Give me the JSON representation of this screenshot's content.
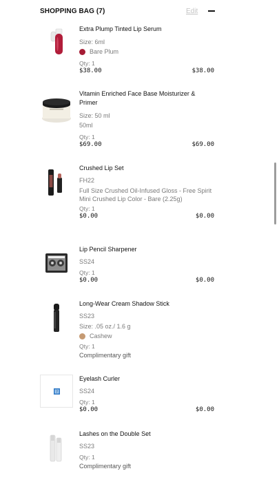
{
  "header": {
    "title": "SHOPPING BAG (7)",
    "edit_label": "Edit"
  },
  "items": [
    {
      "name": "Extra Plump Tinted Lip Serum",
      "size": "Size: 6ml",
      "shade": "Bare Plum",
      "shade_color": "#a51c35",
      "qty": "Qty: 1",
      "unit_price": "$38.00",
      "total_price": "$38.00",
      "icon": "lip-serum-tube-icon"
    },
    {
      "name": "Vitamin Enriched Face Base Moisturizer & Primer",
      "size": "Size: 50 ml",
      "variant": "50ml",
      "qty": "Qty: 1",
      "unit_price": "$69.00",
      "total_price": "$69.00",
      "icon": "moisturizer-jar-icon"
    },
    {
      "name": "Crushed Lip Set",
      "code": "FH22",
      "line1": "Full Size Crushed Oil-Infused Gloss - Free Spirit",
      "line2": "Mini Crushed Lip Color - Bare (2.25g)",
      "qty": "Qty: 1",
      "unit_price": "$0.00",
      "total_price": "$0.00",
      "icon": "lip-set-icon"
    },
    {
      "name": "Lip Pencil Sharpener",
      "code": "SS24",
      "qty": "Qty: 1",
      "unit_price": "$0.00",
      "total_price": "$0.00",
      "icon": "sharpener-icon"
    },
    {
      "name": "Long-Wear Cream Shadow Stick",
      "code": "SS23",
      "size": "Size: .05 oz./ 1.6 g",
      "shade": "Cashew",
      "shade_color": "#c59a73",
      "qty": "Qty: 1",
      "gift": "Complimentary gift",
      "icon": "shadow-stick-icon"
    },
    {
      "name": "Eyelash Curler",
      "code": "SS24",
      "qty": "Qty: 1",
      "unit_price": "$0.00",
      "total_price": "$0.00",
      "icon": "placeholder-image-icon"
    },
    {
      "name": "Lashes on the Double Set",
      "code": "SS23",
      "qty": "Qty: 1",
      "gift": "Complimentary gift",
      "icon": "mascara-set-icon"
    }
  ]
}
